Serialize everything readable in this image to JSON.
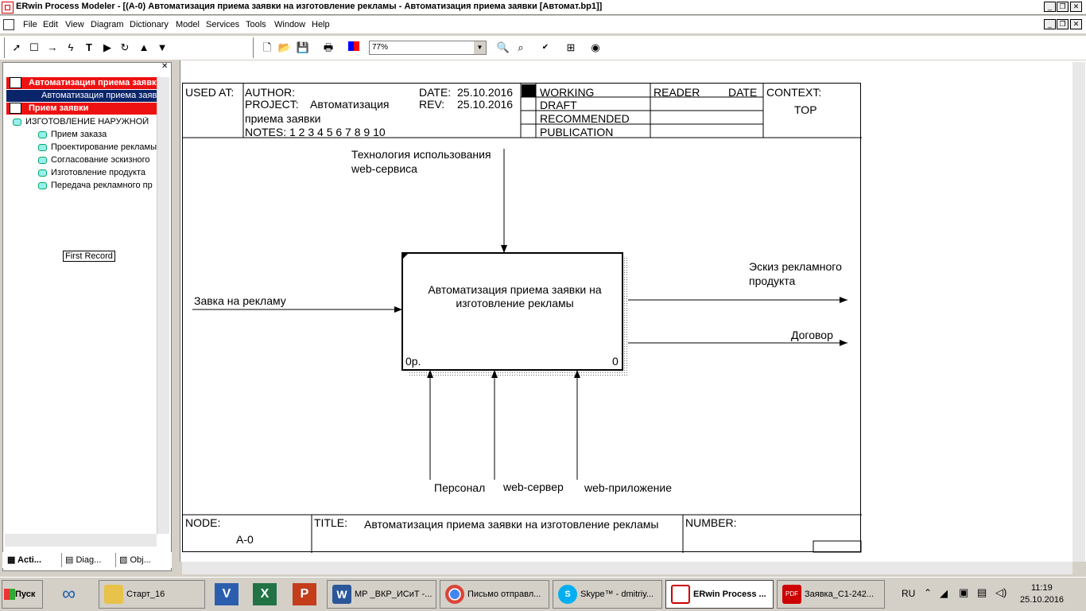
{
  "window": {
    "title": "ERwin Process Modeler - [(A-0) Автоматизация приема  заявки на изготовление  рекламы - Автоматизация приема заявки  [Автомат.bp1]]"
  },
  "menu": [
    "File",
    "Edit",
    "View",
    "Diagram",
    "Dictionary",
    "Model",
    "Services",
    "Tools",
    "Window",
    "Help"
  ],
  "toolbar": {
    "zoom": "77%"
  },
  "tree": {
    "root": "Автоматизация приема заявки",
    "root_child": "Автоматизация приема заявки",
    "model2": "Прием заявки",
    "node": "ИЗГОТОВЛЕНИЕ НАРУЖНОЙ",
    "items": [
      "Прием заказа",
      "Проектирование рекламы",
      "Согласование эскизного",
      "Изготовление продукта",
      "Передача рекламного пр"
    ],
    "tooltip": "First Record",
    "tabs": [
      "Acti...",
      "Diag...",
      "Obj..."
    ]
  },
  "header": {
    "used_at": "USED AT:",
    "author_label": "AUTHOR:",
    "project_label": "PROJECT:",
    "project_value_1": "Автоматизация",
    "project_value_2": "приема заявки",
    "notes": "NOTES:  1  2  3  4  5  6  7  8  9  10",
    "date_label": "DATE:",
    "date_value": "25.10.2016",
    "rev_label": "REV:",
    "rev_value": "25.10.2016",
    "working": "WORKING",
    "draft": "DRAFT",
    "recommended": "RECOMMENDED",
    "publication": "PUBLICATION",
    "reader": "READER",
    "date2": "DATE",
    "context": "CONTEXT:",
    "context_value": "TOP"
  },
  "diagram": {
    "box_title": "Автоматизация приема заявки на изготовление рекламы",
    "box_cost": "0р.",
    "box_num": "0",
    "control": "Технология использования web-сервиса",
    "input": "Завка на рекламу",
    "output1": "Эскиз рекламного продукта",
    "output2": "Договор",
    "mech1": "Персонал",
    "mech2": "web-сервер",
    "mech3": "web-приложение"
  },
  "footer": {
    "node_label": "NODE:",
    "node_value": "A-0",
    "title_label": "TITLE:",
    "title_value": "Автоматизация приема  заявки на изготовление  рекламы",
    "number_label": "NUMBER:"
  },
  "taskbar": {
    "start": "Пуск",
    "buttons": [
      "Старт_16",
      "МР _ВКР_ИСиТ -...",
      "Письмо отправл...",
      "Skype™ - dmitriy...",
      "ERwin Process ...",
      "Заявка_С1-242..."
    ],
    "lang": "RU",
    "time": "11:19",
    "date": "25.10.2016"
  },
  "colors": {
    "selected_red": "#ee1111",
    "selected_blue": "#0a246a",
    "shadow_pattern": "#666666"
  }
}
